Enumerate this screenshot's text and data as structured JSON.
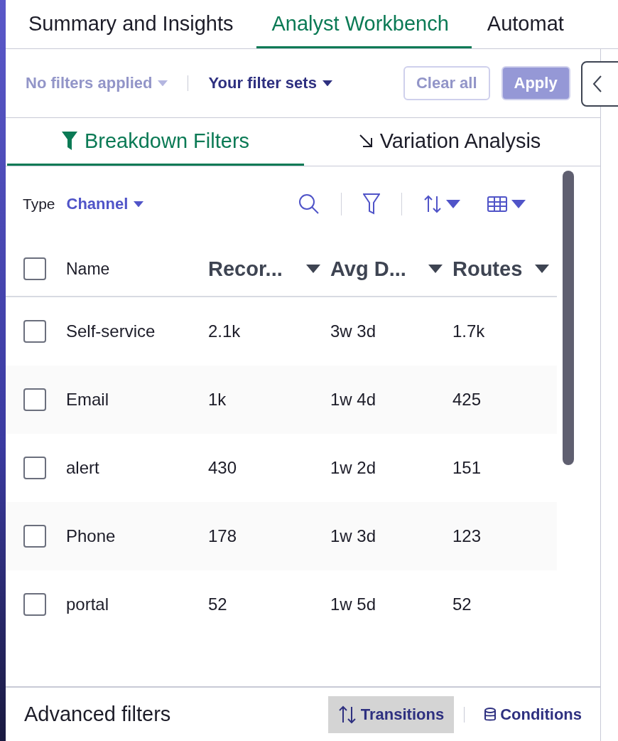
{
  "top_tabs": [
    {
      "label": "Summary and Insights",
      "selected": false
    },
    {
      "label": "Analyst Workbench",
      "selected": true
    },
    {
      "label": "Automat",
      "selected": false
    }
  ],
  "filter_bar": {
    "applied": {
      "label": "No filters applied",
      "disabled": true
    },
    "filter_sets": "Your filter sets",
    "buttons": [
      {
        "label": "Clear all",
        "kind": "outline",
        "disabled": true
      },
      {
        "label": "Apply",
        "kind": "primary",
        "disabled": true
      }
    ]
  },
  "sub_tabs": [
    {
      "label": "Breakdown Filters",
      "kind": "funnel",
      "selected": true
    },
    {
      "label": "Variation Analysis",
      "kind": "arrow",
      "selected": false
    }
  ],
  "type_selector": {
    "label": "Type",
    "value": "Channel"
  },
  "table": {
    "columns": [
      "Name",
      "Recor...",
      "Avg D...",
      "Routes"
    ],
    "all_checked": false,
    "rows": [
      {
        "checked": false,
        "cells": [
          "Self-service",
          "2.1k",
          "3w 3d",
          "1.7k"
        ]
      },
      {
        "checked": false,
        "cells": [
          "Email",
          "1k",
          "1w 4d",
          "425"
        ]
      },
      {
        "checked": false,
        "cells": [
          "alert",
          "430",
          "1w 2d",
          "151"
        ]
      },
      {
        "checked": false,
        "cells": [
          "Phone",
          "178",
          "1w 3d",
          "123"
        ]
      },
      {
        "checked": false,
        "cells": [
          "portal",
          "52",
          "1w 5d",
          "52"
        ]
      }
    ]
  },
  "advanced_filters": {
    "title": "Advanced filters",
    "buttons": [
      {
        "label": "Transitions",
        "kind": "transitions",
        "selected": true
      },
      {
        "label": "Conditions",
        "kind": "conditions",
        "selected": false
      }
    ]
  }
}
